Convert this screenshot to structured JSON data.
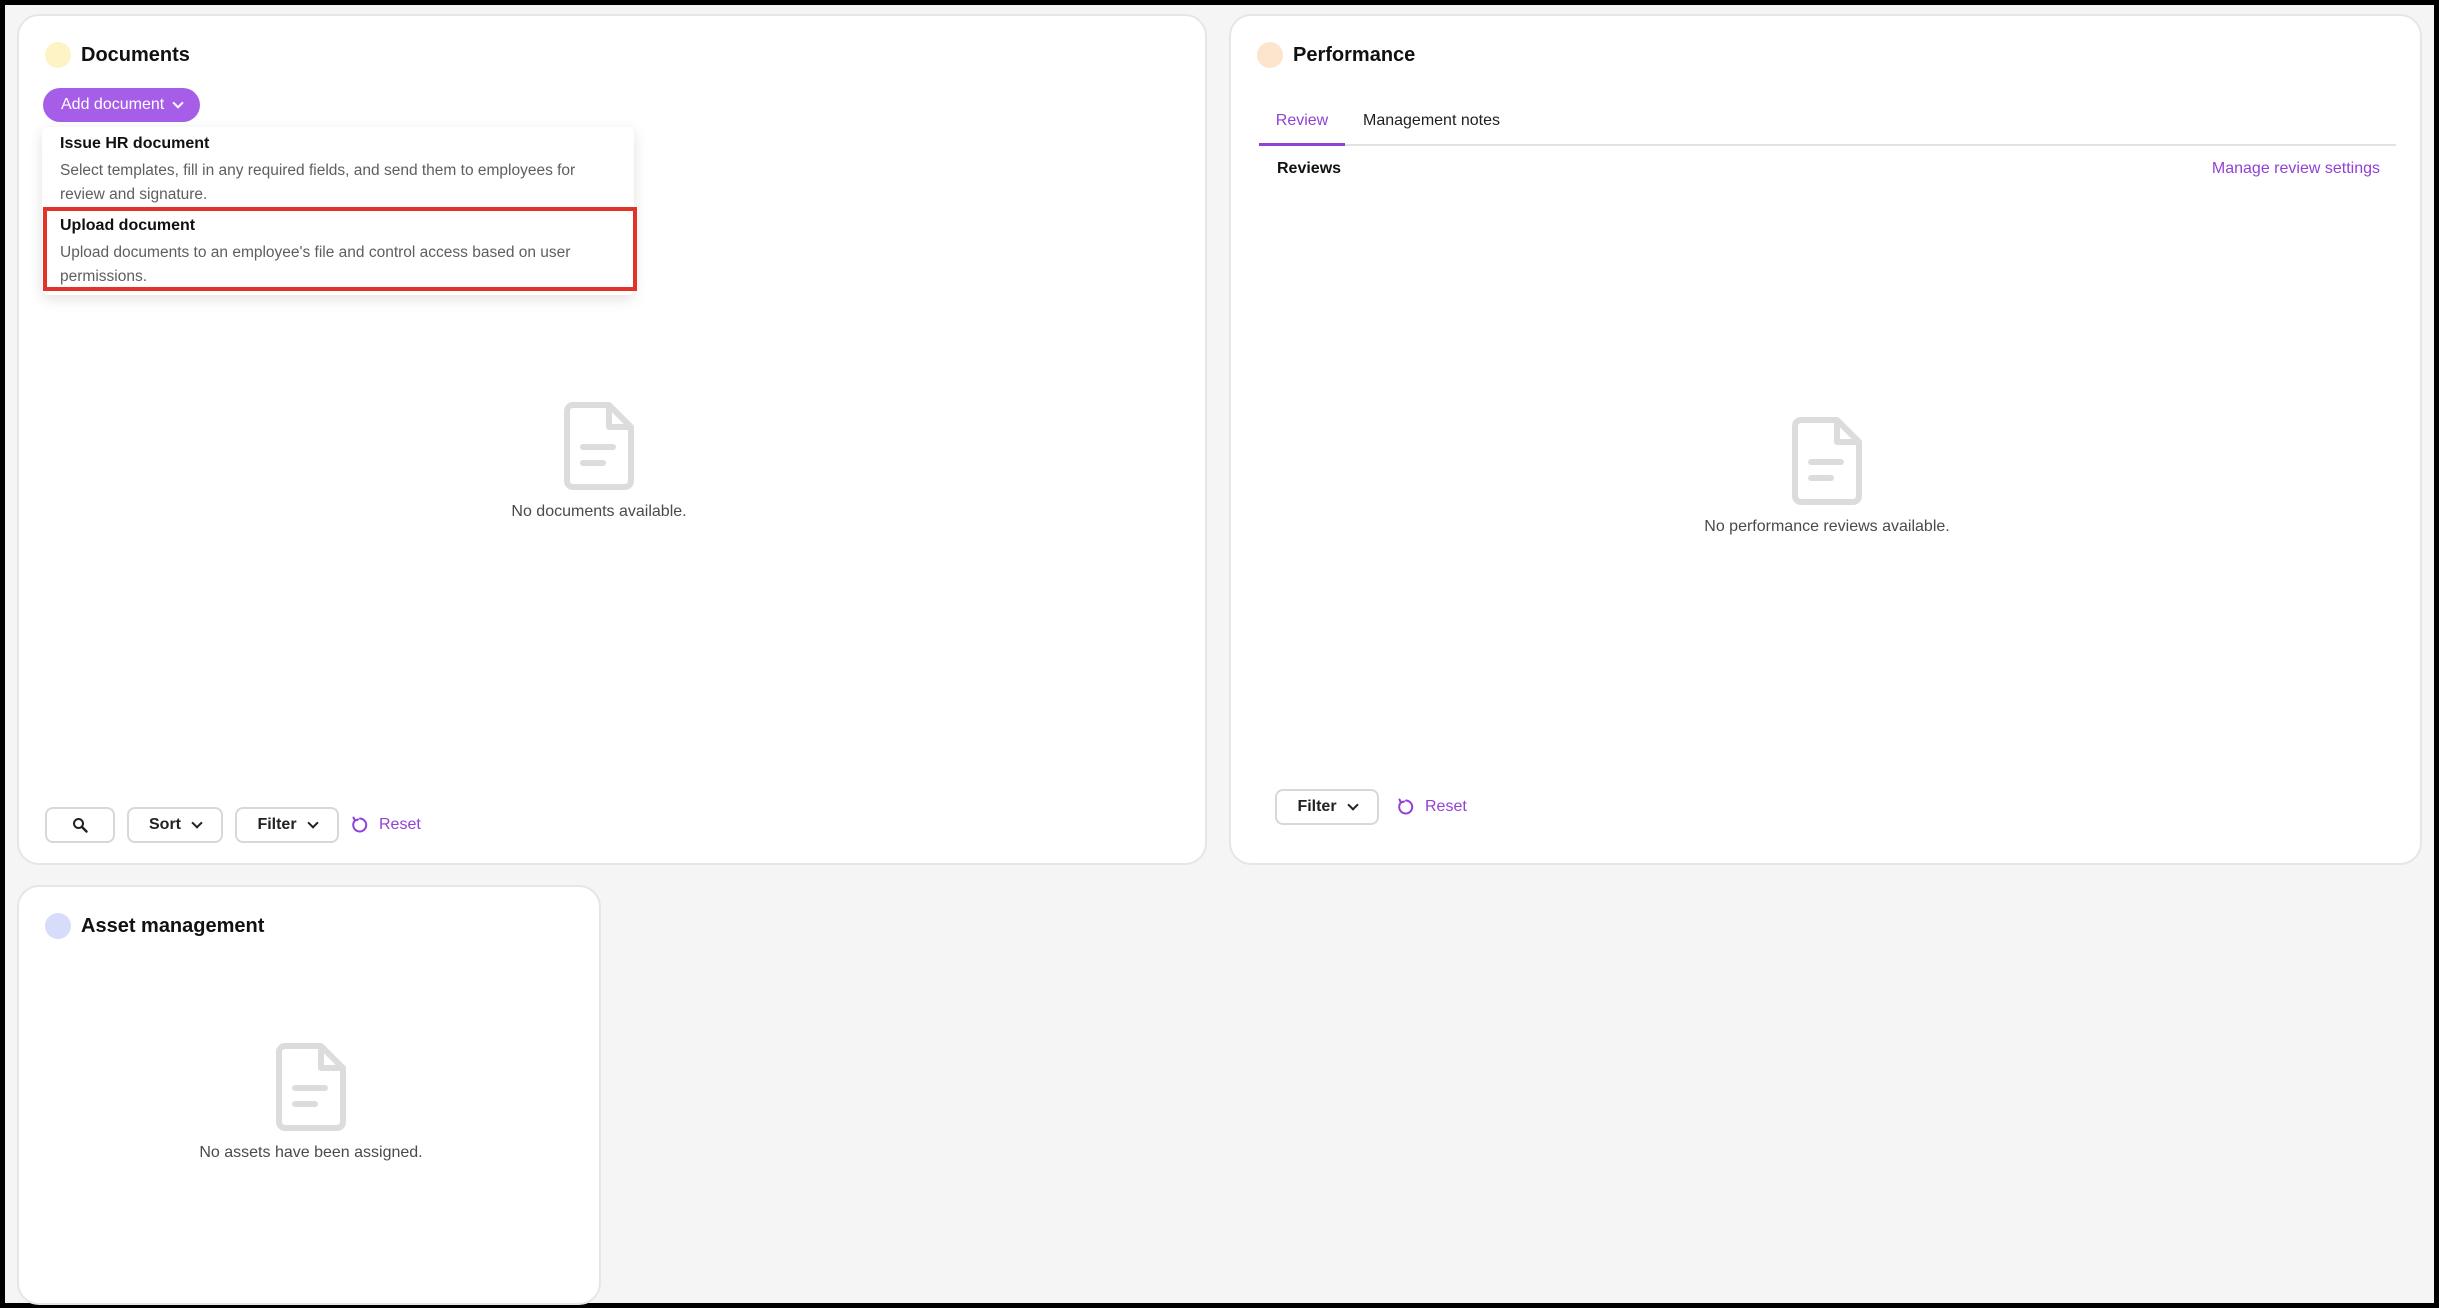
{
  "documents": {
    "title": "Documents",
    "dot_color": "#fdf3c4",
    "add_button": "Add document",
    "menu": [
      {
        "title": "Issue HR document",
        "desc": "Select templates, fill in any required fields, and send them to employees for review and signature."
      },
      {
        "title": "Upload document",
        "desc": "Upload documents to an employee's file and control access based on user permissions."
      }
    ],
    "empty_text": "No documents available.",
    "toolbar": {
      "sort": "Sort",
      "filter": "Filter",
      "reset": "Reset"
    }
  },
  "performance": {
    "title": "Performance",
    "dot_color": "#fde4cc",
    "tabs": [
      "Review",
      "Management notes"
    ],
    "section_title": "Reviews",
    "manage_link": "Manage review settings",
    "empty_text": "No performance reviews available.",
    "toolbar": {
      "filter": "Filter",
      "reset": "Reset"
    }
  },
  "assets": {
    "title": "Asset management",
    "dot_color": "#d7dcfb",
    "empty_text": "No assets have been assigned."
  },
  "colors": {
    "accent": "#a65ee8",
    "link": "#9240d6",
    "highlight": "#e0342b"
  },
  "icons": [
    "chevron-down-icon",
    "document-icon",
    "search-icon",
    "reset-icon"
  ]
}
